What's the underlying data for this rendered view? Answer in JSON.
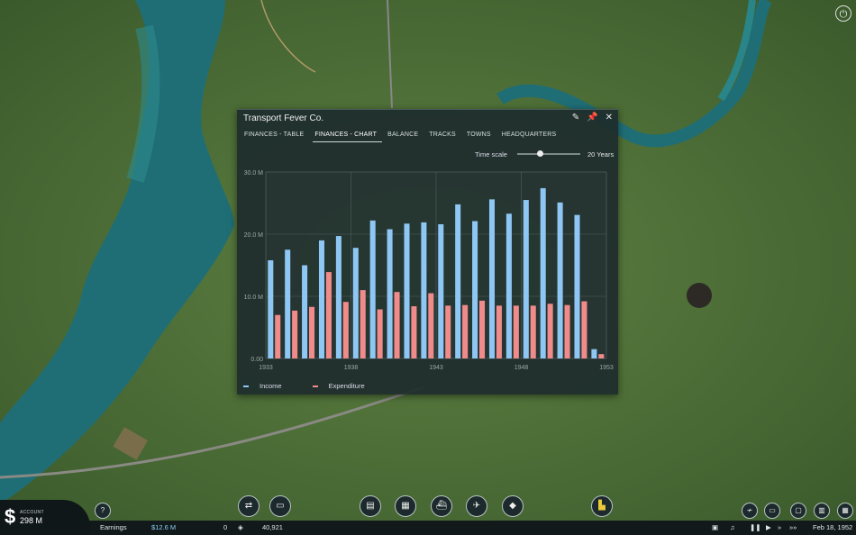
{
  "window": {
    "title": "Transport Fever Co.",
    "tabs": [
      {
        "label": "FINANCES - TABLE",
        "active": false
      },
      {
        "label": "FINANCES - CHART",
        "active": true
      },
      {
        "label": "BALANCE",
        "active": false
      },
      {
        "label": "TRACKS",
        "active": false
      },
      {
        "label": "TOWNS",
        "active": false
      },
      {
        "label": "HEADQUARTERS",
        "active": false
      }
    ],
    "icons": [
      "pencil-icon",
      "pin-icon",
      "close-icon"
    ],
    "time_scale": {
      "label": "Time scale",
      "value": "20 Years",
      "position": 0.35
    }
  },
  "chart_data": {
    "type": "bar",
    "x": [
      1933,
      1934,
      1935,
      1936,
      1937,
      1938,
      1939,
      1940,
      1941,
      1942,
      1943,
      1944,
      1945,
      1946,
      1947,
      1948,
      1949,
      1950,
      1951,
      1952
    ],
    "x_tick_labels": [
      "1933",
      "1938",
      "1943",
      "1948",
      "1953"
    ],
    "y_tick_labels": [
      "0.00",
      "10.0 M",
      "20.0 M",
      "30.0 M"
    ],
    "ylim": [
      0,
      30
    ],
    "grid": true,
    "legend": "bottom-left",
    "series": [
      {
        "name": "Income",
        "color": "#8ec6f4",
        "values": [
          15.8,
          17.5,
          15.0,
          19.0,
          19.7,
          17.8,
          22.2,
          20.8,
          21.7,
          21.9,
          21.6,
          24.8,
          22.1,
          25.6,
          23.3,
          25.5,
          27.4,
          25.1,
          23.1,
          1.5
        ]
      },
      {
        "name": "Expenditure",
        "color": "#f08b8b",
        "values": [
          7.0,
          7.7,
          8.3,
          13.9,
          9.1,
          11.0,
          7.9,
          10.7,
          8.4,
          10.5,
          8.5,
          8.6,
          9.3,
          8.5,
          8.5,
          8.5,
          8.8,
          8.6,
          9.2,
          0.7
        ]
      }
    ]
  },
  "hud": {
    "account_label": "ACCOUNT",
    "account_value": "298 M",
    "currency_symbol": "$",
    "earnings_label": "Earnings",
    "earnings_value": "$12.6 M",
    "vehicle_count": "0",
    "cargo_value": "40,921",
    "date": "Feb 18, 1952",
    "help_icon": "?"
  }
}
